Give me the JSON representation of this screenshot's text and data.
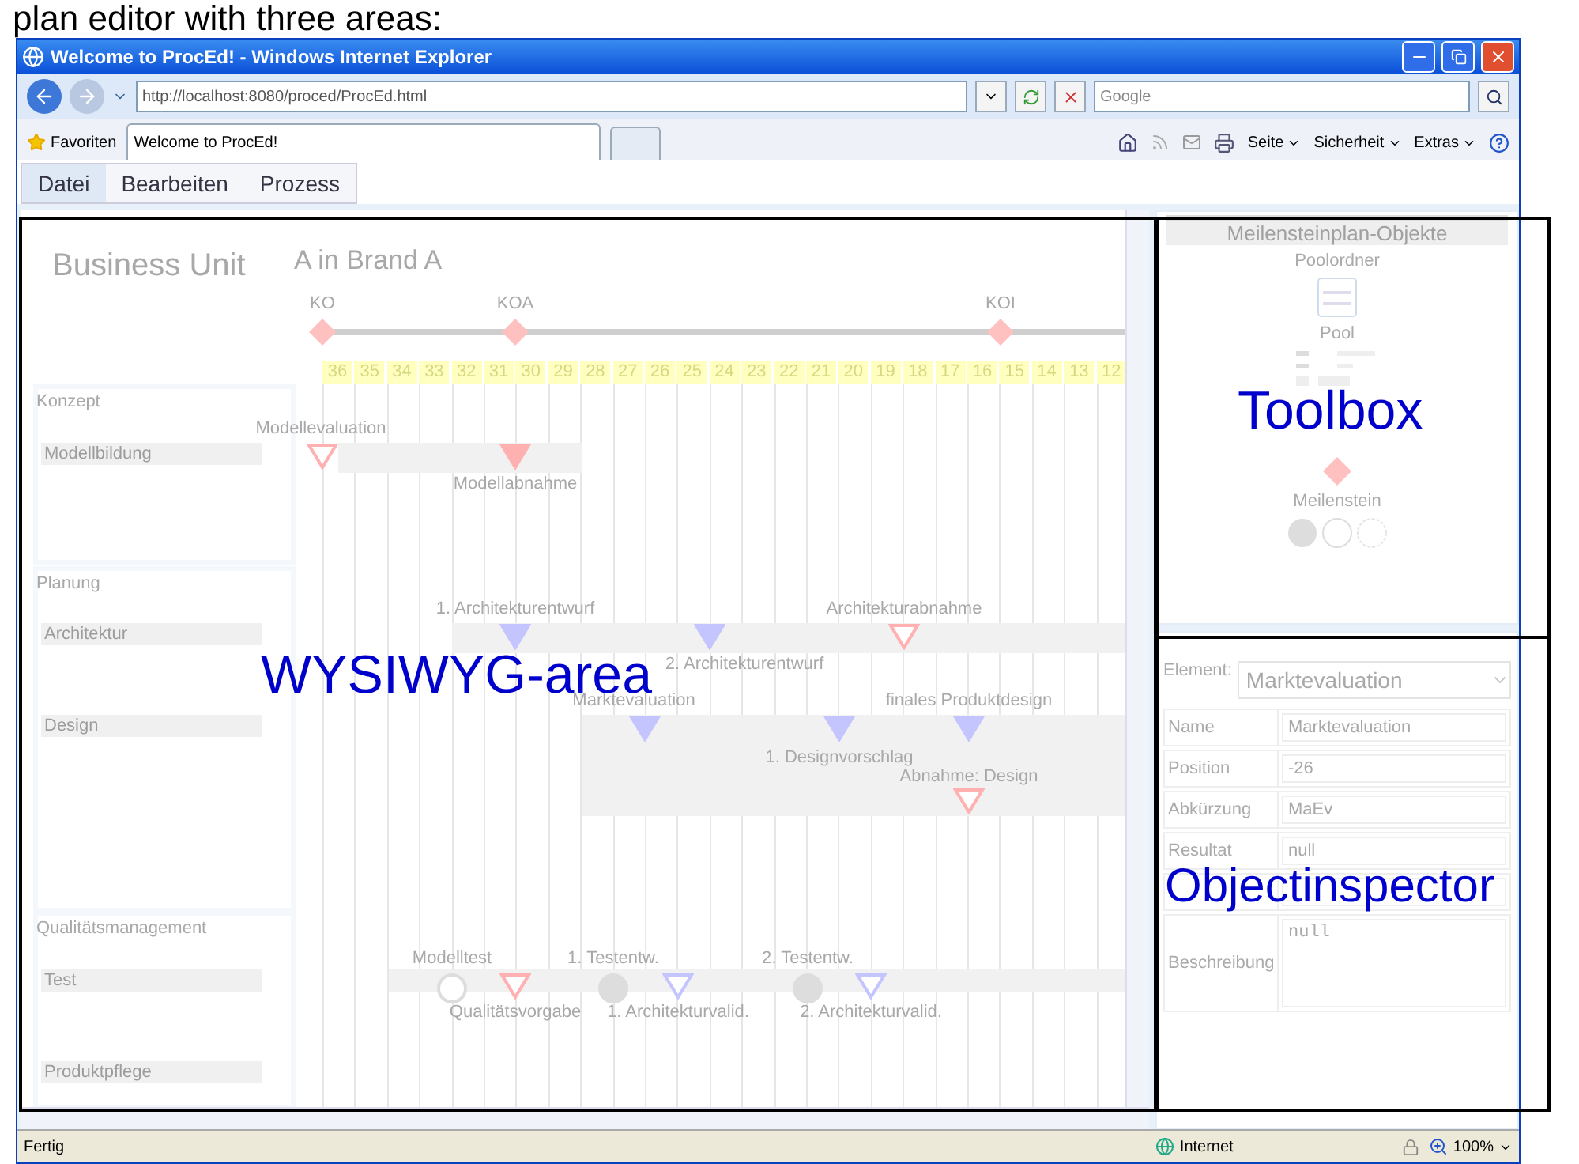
{
  "slide_heading": "plan editor with three areas:",
  "window": {
    "title": "Welcome to ProcEd! - Windows Internet Explorer"
  },
  "address_bar": {
    "url": "http://localhost:8080/proced/ProcEd.html"
  },
  "search": {
    "placeholder": "Google"
  },
  "favorites": "Favoriten",
  "tabs": [
    {
      "label": "Welcome to ProcEd!",
      "selected": true
    }
  ],
  "command_bar": [
    "Seite",
    "Sicherheit",
    "Extras"
  ],
  "menu": [
    {
      "label": "Datei",
      "selected": true
    },
    {
      "label": "Bearbeiten",
      "selected": false
    },
    {
      "label": "Prozess",
      "selected": false
    }
  ],
  "plan": {
    "title": "Business Unit",
    "subtitle": "A in Brand A",
    "main_milestones": [
      "KO",
      "KOA",
      "KOI"
    ],
    "weeks": [
      "36",
      "35",
      "34",
      "33",
      "32",
      "31",
      "30",
      "29",
      "28",
      "27",
      "26",
      "25",
      "24",
      "23",
      "22",
      "21",
      "20",
      "19",
      "18",
      "17",
      "16",
      "15",
      "14",
      "13",
      "12"
    ],
    "phases": [
      {
        "name": "Konzept",
        "rows": [
          "Modellbildung"
        ]
      },
      {
        "name": "Planung",
        "rows": [
          "Architektur",
          "Design"
        ]
      },
      {
        "name": "Qualitätsmanagement",
        "rows": [
          "Test",
          "Produktpflege"
        ]
      }
    ],
    "milestones": [
      {
        "label": "Modellevaluation",
        "kind": "triangle",
        "filled": false,
        "color": "#ffb0b0"
      },
      {
        "label": "Modellabnahme",
        "kind": "triangle",
        "filled": true,
        "color": "#ffb0b0"
      },
      {
        "label": "1. Architekturentwurf",
        "kind": "triangle",
        "filled": true,
        "color": "#c4c4ff"
      },
      {
        "label": "2. Architekturentwurf",
        "kind": "triangle",
        "filled": true,
        "color": "#c4c4ff"
      },
      {
        "label": "Architekturabnahme",
        "kind": "triangle",
        "filled": false,
        "color": "#ffb0b0"
      },
      {
        "label": "Marktevaluation",
        "kind": "triangle",
        "filled": true,
        "color": "#c4c4ff"
      },
      {
        "label": "1. Designvorschlag",
        "kind": "triangle",
        "filled": true,
        "color": "#c4c4ff"
      },
      {
        "label": "finales Produktdesign",
        "kind": "triangle",
        "filled": true,
        "color": "#c4c4ff"
      },
      {
        "label": "Abnahme: Design",
        "kind": "triangle",
        "filled": false,
        "color": "#ffb0b0"
      },
      {
        "label": "Modelltest",
        "kind": "circle",
        "filled": false,
        "color": "#dddddd"
      },
      {
        "label": "Qualitätsvorgabe",
        "kind": "triangle",
        "filled": false,
        "color": "#ffb0b0"
      },
      {
        "label": "1. Testentw.",
        "kind": "circle",
        "filled": true,
        "color": "#dddddd"
      },
      {
        "label": "1. Architekturvalid.",
        "kind": "triangle",
        "filled": false,
        "color": "#c4c4ff"
      },
      {
        "label": "2. Testentw.",
        "kind": "circle",
        "filled": true,
        "color": "#dddddd"
      },
      {
        "label": "2. Architekturvalid.",
        "kind": "triangle",
        "filled": false,
        "color": "#c4c4ff"
      }
    ]
  },
  "toolbox": {
    "title": "Meilensteinplan-Objekte",
    "items": [
      {
        "label": "Poolordner",
        "kind": "folder"
      },
      {
        "label": "Pool",
        "kind": "pool"
      },
      {
        "label": "Meilenstein",
        "kind": "milestone"
      }
    ]
  },
  "inspector": {
    "element_label": "Element:",
    "element_value": "Marktevaluation",
    "fields": [
      {
        "label": "Name",
        "value": "Marktevaluation",
        "kind": "input"
      },
      {
        "label": "Position",
        "value": "-26",
        "kind": "input"
      },
      {
        "label": "Abkürzung",
        "value": "MaEv",
        "kind": "input"
      },
      {
        "label": "Resultat",
        "value": "null",
        "kind": "input"
      },
      {
        "label": "Beschreibung",
        "value": "null",
        "kind": "textarea"
      }
    ]
  },
  "status_bar": {
    "text": "Fertig",
    "zone": "Internet",
    "zoom": "100%"
  },
  "annotations": [
    "WYSIWYG-area",
    "Toolbox",
    "Objectinspector"
  ]
}
